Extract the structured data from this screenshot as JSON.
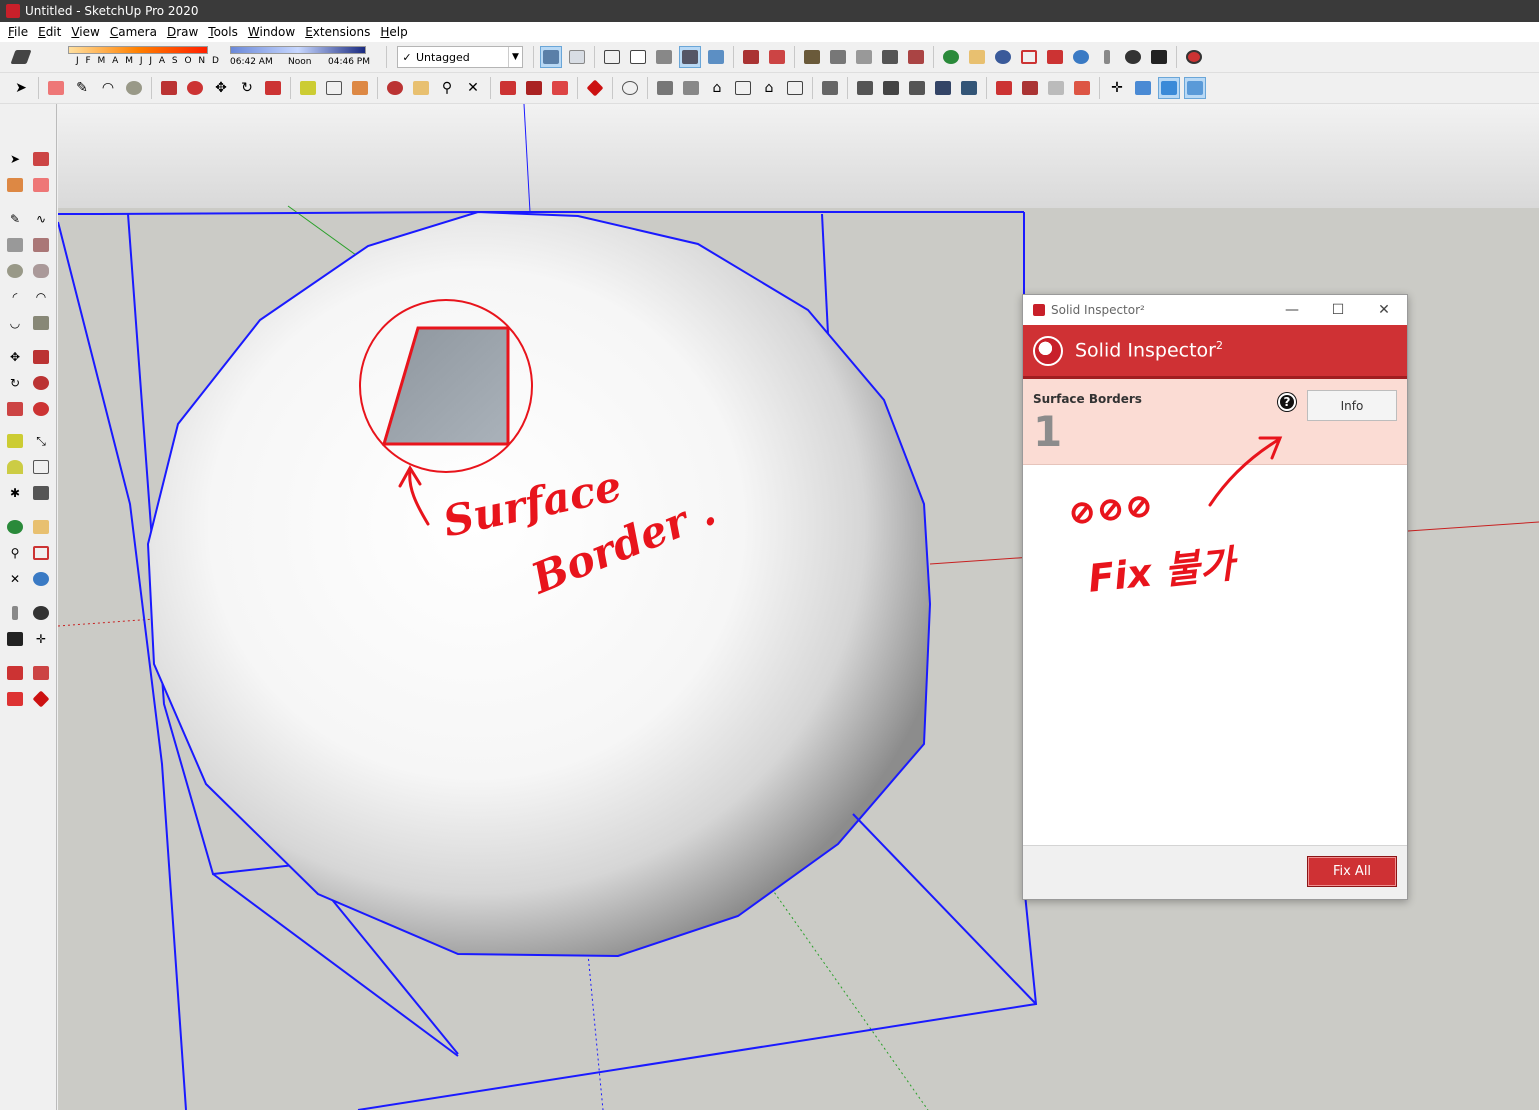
{
  "window": {
    "title": "Untitled - SketchUp Pro 2020"
  },
  "menu": [
    "File",
    "Edit",
    "View",
    "Camera",
    "Draw",
    "Tools",
    "Window",
    "Extensions",
    "Help"
  ],
  "shadow": {
    "months": "J F M A M J J A S O N D",
    "time_start": "06:42 AM",
    "time_mid": "Noon",
    "time_end": "04:46 PM"
  },
  "tags": {
    "selected": "Untagged"
  },
  "inspector": {
    "window_title": "Solid Inspector²",
    "header_title": "Solid Inspector",
    "header_sup": "2",
    "error_name": "Surface Borders",
    "error_count": "1",
    "help_glyph": "?",
    "info_label": "Info",
    "fix_label": "Fix All"
  },
  "annotations": {
    "label_line1": "Surface",
    "label_line2": "Border .",
    "note_line1": "⊘⊘⊘",
    "note_line2": "Fix 불가"
  },
  "colors": {
    "accent_red": "#cf3134",
    "error_bg": "#fbdcd4",
    "bbox_blue": "#1a1aff",
    "ink_red": "#e8141c"
  }
}
